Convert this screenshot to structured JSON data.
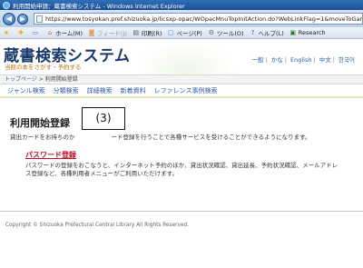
{
  "window": {
    "title": "利用開始申請：蔵書検索システム - Windows Internet Explorer"
  },
  "addressbar": {
    "url": "https://www.tosyokan.pref.shizuoka.jp/licsxp-opac/WOpacMnuTopInitAction.do?WebLinkFlag=1&moveToGamenId"
  },
  "toolbar": {
    "items": [
      {
        "label": "ホーム(M)"
      },
      {
        "label": "フィード(J)"
      },
      {
        "label": "印刷(R)"
      },
      {
        "label": "ページ(P)"
      },
      {
        "label": "ツール(O)"
      },
      {
        "label": "ヘルプ(L)"
      },
      {
        "label": "Research"
      }
    ]
  },
  "site": {
    "title": "蔵書検索システム",
    "subtitle": "当館の本をさがす・予約する",
    "lang_links": [
      "一般",
      "かな",
      "English",
      "中文",
      "한국어"
    ]
  },
  "breadcrumb": {
    "home": "トップページ",
    "current": "利用開始登録"
  },
  "nav": {
    "items": [
      "ジャンル検索",
      "分類検索",
      "詳細検索",
      "新着資料",
      "レファレンス事例検索"
    ]
  },
  "main": {
    "heading": "利用開始登録",
    "intro_prefix": "貸出カードをお持ちのか",
    "intro_suffix": "ード登録を行うことで各種サービスを受けることができるようになります。",
    "callout": "(3)",
    "password_link": "パスワード登録",
    "password_desc": "パスワードの登録をおこなうと、インターネット予約のほか、貸出状況確認、貸出延長、予約状況確認、メールアドレス登録など、各種利用者メニューがご利用いただけます。"
  },
  "footer": {
    "copyright": "Copyright © Shizuoka Prefectural Central Library All Rights Reserved."
  }
}
